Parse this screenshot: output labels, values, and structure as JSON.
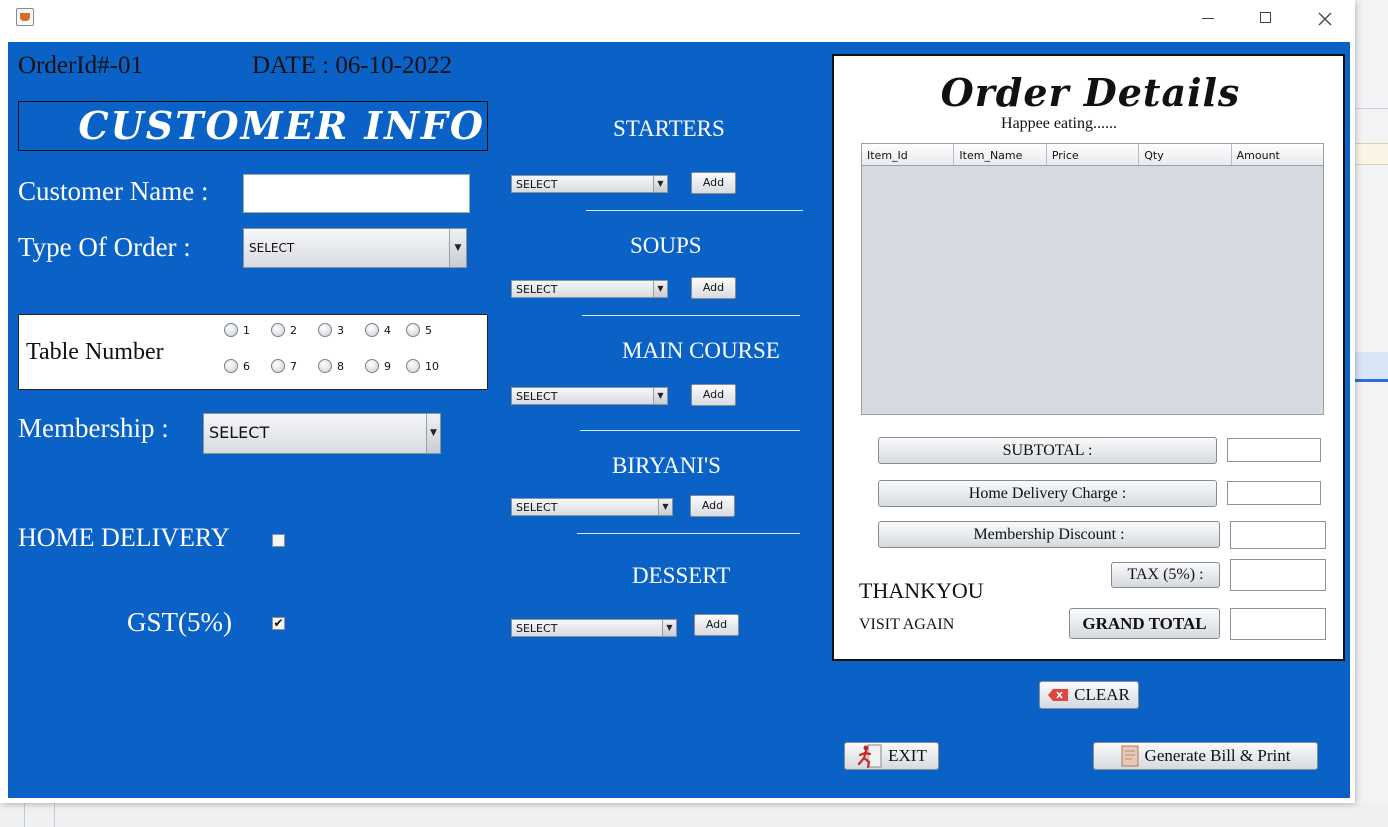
{
  "header": {
    "order_id": "OrderId#-01",
    "date": "DATE : 06-10-2022"
  },
  "customer": {
    "title": "CUSTOMER INFO",
    "name_label": "Customer Name :",
    "name_value": "",
    "order_type_label": "Type  Of  Order :",
    "order_type_value": "SELECT",
    "table_label": "Table Number",
    "tables": [
      "1",
      "2",
      "3",
      "4",
      "5",
      "6",
      "7",
      "8",
      "9",
      "10"
    ],
    "membership_label": "Membership :",
    "membership_value": "SELECT",
    "home_delivery_label": "HOME DELIVERY",
    "home_delivery_checked": false,
    "gst_label": "GST(5%)",
    "gst_checked": true,
    "gst_check_glyph": "✔"
  },
  "menu": {
    "categories": [
      {
        "title": "STARTERS",
        "select": "SELECT",
        "add": "Add"
      },
      {
        "title": "SOUPS",
        "select": "SELECT",
        "add": "Add"
      },
      {
        "title": "MAIN COURSE",
        "select": "SELECT",
        "add": "Add"
      },
      {
        "title": "BIRYANI'S",
        "select": "SELECT",
        "add": "Add"
      },
      {
        "title": "DESSERT",
        "select": "SELECT",
        "add": "Add"
      }
    ]
  },
  "order": {
    "title": "Order Details",
    "subtitle": "Happee eating......",
    "columns": [
      "Item_Id",
      "Item_Name",
      "Price",
      "Qty",
      "Amount"
    ],
    "rows": [],
    "subtotal_label": "SUBTOTAL :",
    "delivery_label": "Home Delivery Charge :",
    "discount_label": "Membership Discount :",
    "tax_label": "TAX (5%) :",
    "grand_total_label": "GRAND TOTAL",
    "thankyou": "THANKYOU",
    "visit_again": "VISIT AGAIN"
  },
  "actions": {
    "clear": "CLEAR",
    "exit": "EXIT",
    "generate": "Generate Bill & Print"
  },
  "colors": {
    "panel": "#0a62c7",
    "text_light": "#ffffff"
  },
  "icons": [
    "app-java-icon",
    "minimize-icon",
    "maximize-icon",
    "close-icon",
    "clear-icon",
    "exit-runner-icon",
    "bill-icon"
  ]
}
